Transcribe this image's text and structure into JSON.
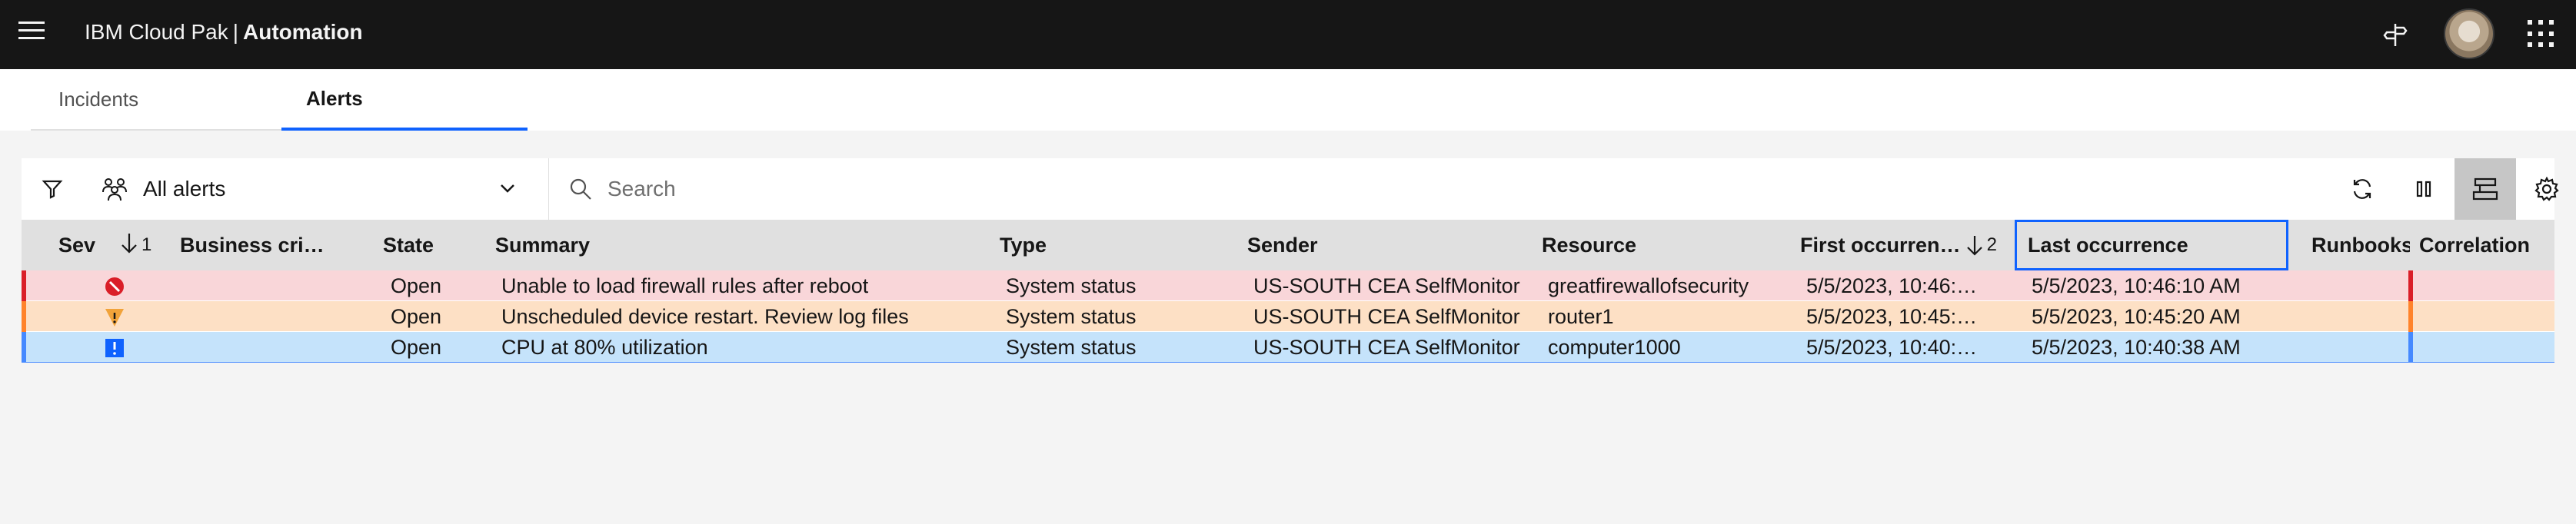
{
  "header": {
    "brand_prefix": "IBM Cloud Pak",
    "brand_separator": "|",
    "brand_product": "Automation",
    "icons": [
      "menu-icon",
      "signpost-icon",
      "avatar",
      "app-switcher-icon"
    ]
  },
  "tabs": [
    {
      "label": "Incidents",
      "active": false
    },
    {
      "label": "Alerts",
      "active": true
    }
  ],
  "toolbar": {
    "filter_icon": "filter-icon",
    "view_select": "All alerts",
    "search_placeholder": "Search",
    "buttons": [
      "refresh-icon",
      "pause-icon",
      "group-icon",
      "settings-icon"
    ]
  },
  "table": {
    "columns": {
      "sev": "Sev",
      "sev_sort_order": "1",
      "business": "Business cri…",
      "state": "State",
      "summary": "Summary",
      "type": "Type",
      "sender": "Sender",
      "resource": "Resource",
      "first": "First occurren…",
      "first_sort_order": "2",
      "last": "Last occurrence",
      "runbooks": "Runbooks",
      "correlation": "Correlation"
    },
    "rows": [
      {
        "severity": "critical",
        "state": "Open",
        "summary": "Unable to load firewall rules after reboot",
        "type": "System status",
        "sender": "US-SOUTH CEA SelfMonitor",
        "resource": "greatfirewallofsecurity",
        "first": "5/5/2023, 10:46:…",
        "last": "5/5/2023, 10:46:10 AM",
        "color": "#da1e28",
        "bg": "#f9d6d9"
      },
      {
        "severity": "warning",
        "state": "Open",
        "summary": "Unscheduled device restart. Review log files",
        "type": "System status",
        "sender": "US-SOUTH CEA SelfMonitor",
        "resource": "router1",
        "first": "5/5/2023, 10:45:…",
        "last": "5/5/2023, 10:45:20 AM",
        "color": "#ff832b",
        "bg": "#fde0c5"
      },
      {
        "severity": "information",
        "state": "Open",
        "summary": "CPU at 80% utilization",
        "type": "System status",
        "sender": "US-SOUTH CEA SelfMonitor",
        "resource": "computer1000",
        "first": "5/5/2023, 10:40:…",
        "last": "5/5/2023, 10:40:38 AM",
        "color": "#4589ff",
        "bg": "#c5e3fb"
      }
    ]
  }
}
